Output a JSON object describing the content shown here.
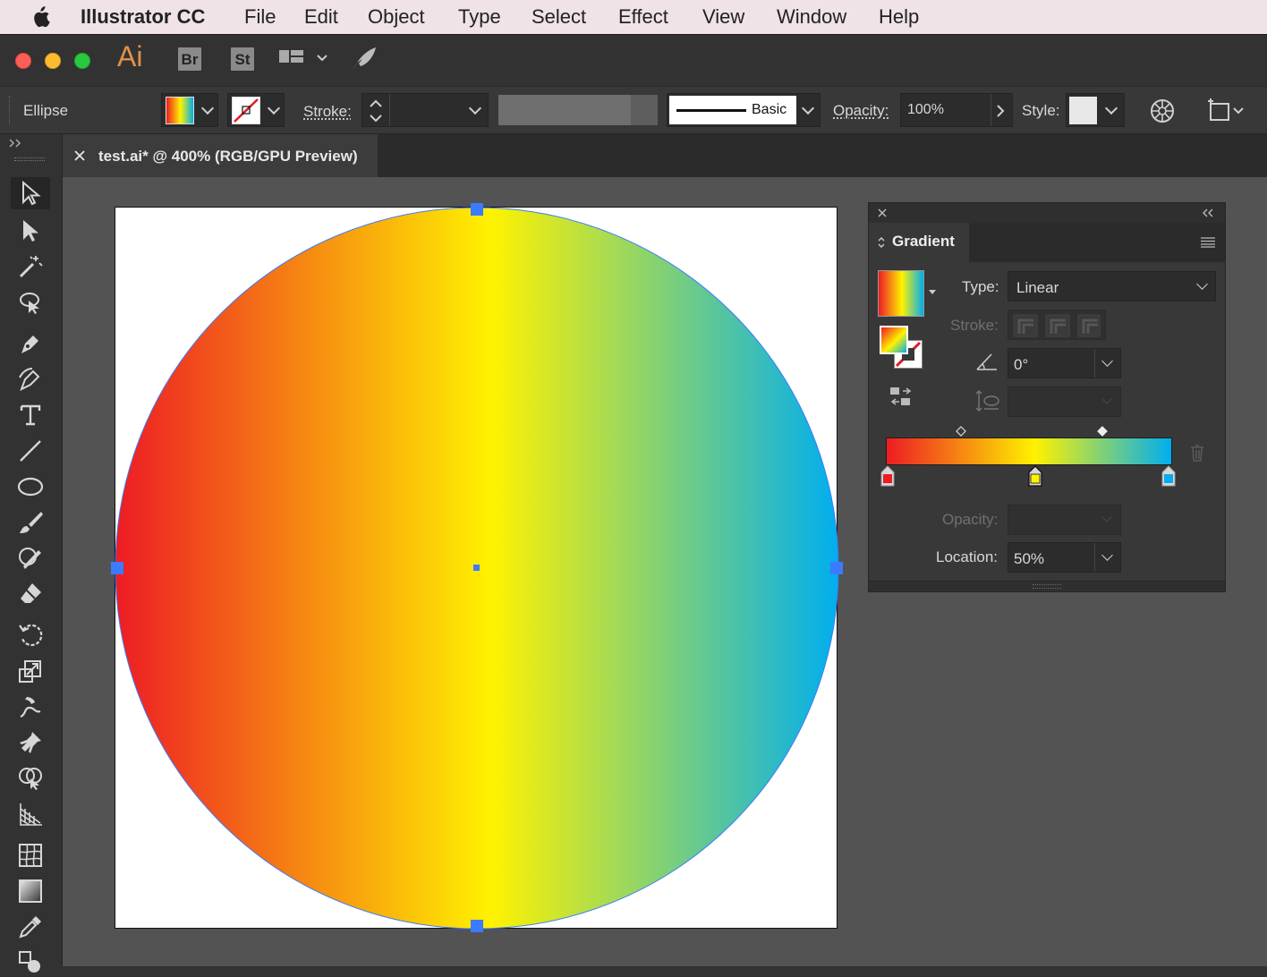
{
  "menubar": {
    "app_name": "Illustrator CC",
    "items": [
      "File",
      "Edit",
      "Object",
      "Type",
      "Select",
      "Effect",
      "View",
      "Window",
      "Help"
    ]
  },
  "appbar": {
    "logo": "Ai",
    "bridge_label": "Br",
    "stock_label": "St"
  },
  "control_bar": {
    "selection_label": "Ellipse",
    "stroke_label": "Stroke:",
    "brush_label": "Basic",
    "opacity_label": "Opacity:",
    "opacity_value": "100%",
    "style_label": "Style:"
  },
  "document_tab": {
    "title": "test.ai* @ 400% (RGB/GPU Preview)"
  },
  "gradient_panel": {
    "title": "Gradient",
    "type_label": "Type:",
    "type_value": "Linear",
    "stroke_label": "Stroke:",
    "angle_value": "0°",
    "opacity_label": "Opacity:",
    "location_label": "Location:",
    "location_value": "50%",
    "stops": [
      {
        "color": "#ed1c24",
        "location": 0
      },
      {
        "color": "#fff200",
        "location": 0.52
      },
      {
        "color": "#00aeef",
        "location": 1
      }
    ]
  },
  "colors": {
    "selection": "#3a7bff",
    "gradient_start": "#ed1c24",
    "gradient_mid": "#fff200",
    "gradient_end": "#00aeef"
  },
  "tools": [
    "selection-tool-icon",
    "direct-selection-tool-icon",
    "magic-wand-tool-icon",
    "lasso-tool-icon",
    "pen-tool-icon",
    "curvature-tool-icon",
    "type-tool-icon",
    "line-tool-icon",
    "ellipse-tool-icon",
    "paintbrush-tool-icon",
    "shaper-tool-icon",
    "eraser-tool-icon",
    "rotate-tool-icon",
    "scale-tool-icon",
    "warp-tool-icon",
    "puppet-warp-tool-icon",
    "shape-builder-tool-icon",
    "perspective-grid-tool-icon",
    "mesh-tool-icon",
    "gradient-tool-icon",
    "eyedropper-tool-icon",
    "blend-tool-icon"
  ]
}
